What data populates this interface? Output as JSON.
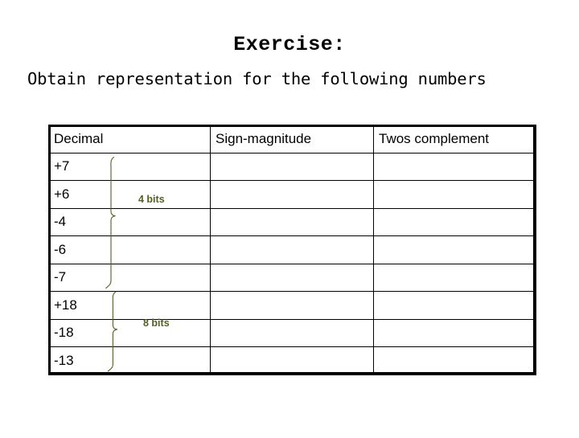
{
  "slide": {
    "title": "Exercise:",
    "instruction": "Obtain representation for the following numbers",
    "background_color": "#ffffff",
    "text_color": "#000000"
  },
  "table": {
    "headers": [
      "Decimal",
      "Sign-magnitude",
      "Twos complement"
    ],
    "rows": [
      {
        "decimal": "+7",
        "sign_magnitude": "",
        "twos_complement": ""
      },
      {
        "decimal": "+6",
        "sign_magnitude": "",
        "twos_complement": ""
      },
      {
        "decimal": "-4",
        "sign_magnitude": "",
        "twos_complement": ""
      },
      {
        "decimal": "-6",
        "sign_magnitude": "",
        "twos_complement": ""
      },
      {
        "decimal": "-7",
        "sign_magnitude": "",
        "twos_complement": ""
      },
      {
        "decimal": "+18",
        "sign_magnitude": "",
        "twos_complement": ""
      },
      {
        "decimal": "-18",
        "sign_magnitude": "",
        "twos_complement": ""
      },
      {
        "decimal": "-13",
        "sign_magnitude": "",
        "twos_complement": ""
      }
    ],
    "border_color": "#000000"
  },
  "annotations": {
    "color": "#55601f",
    "groups": [
      {
        "label": "4 bits",
        "covers": [
          "+7",
          "+6",
          "-4",
          "-6",
          "-7"
        ]
      },
      {
        "label": "8 bits",
        "covers": [
          "+18",
          "-18",
          "-13"
        ]
      }
    ]
  }
}
